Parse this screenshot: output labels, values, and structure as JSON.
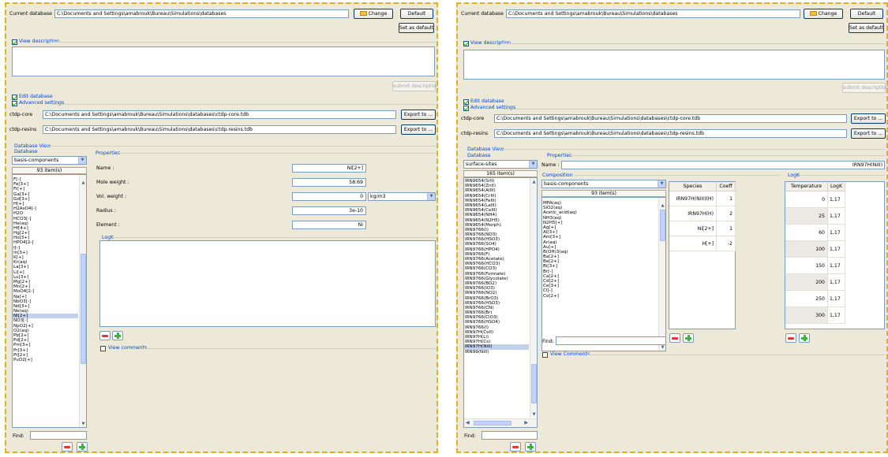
{
  "left": {
    "db_label": "Current database",
    "db_path": "C:\\Documents and Settings\\amabrouk\\Bureau\\Simulations\\databases",
    "change_label": "Change",
    "default_label": "Default",
    "set_default_label": "Set as default",
    "view_description_label": "View description",
    "submit_description_label": "submit description",
    "edit_database_label": "Edit database",
    "advanced_settings_label": "Advanced settings",
    "core_label": "ctdp-core",
    "core_path": "C:\\Documents and Settings\\amabrouk\\Bureau\\Simulations\\databases\\ctdp-core.tdb",
    "resins_label": "ctdp-resins",
    "resins_path": "C:\\Documents and Settings\\amabrouk\\Bureau\\Simulations\\databases\\ctdp-resins.tdb",
    "export_label": "Export to ...",
    "db_view_label": "Database View",
    "database_label": "Database",
    "db_select": "basis-components",
    "item_count": "93  item(s)",
    "items": [
      "F[-]",
      "Fe[3+]",
      "Fr[+]",
      "Ga[3+]",
      "Gd[3+]",
      "H[+]",
      "H2AsO4[-]",
      "H2O",
      "HCO3[-]",
      "He(aq)",
      "Hf[4+]",
      "Hg[2+]",
      "Ho[3+]",
      "HPO4[2-]",
      "I[-]",
      "In[3+]",
      "K[+]",
      "Kr(aq)",
      "La[3+]",
      "Li[+]",
      "Lu[3+]",
      "Mg[2+]",
      "Mn[2+]",
      "MoO4[2-]",
      "Na[+]",
      "NbO3[-]",
      "Nd[3+]",
      "Ne(aq)",
      "Ni[2+]",
      "NO3[-]",
      "NpO2[+]",
      "O2(aq)",
      "Pb[2+]",
      "Pd[2+]",
      "Pm[3+]",
      "Pr[3+]",
      "Pt[2+]",
      "PuO2[+]"
    ],
    "selected_index": 28,
    "find_label": "Find:",
    "find_value": "",
    "properties_label": "Properties",
    "name_label": "Name :",
    "name_value": "Ni[2+]",
    "mole_weight_label": "Mole weight :",
    "mole_weight_value": "58.69",
    "vol_weight_label": "Vol. weight :",
    "vol_weight_value": "0",
    "vol_weight_unit": "kg/m3",
    "radius_label": "Radius :",
    "radius_value": "3e-10",
    "element_label": "Element :",
    "element_value": "Ni",
    "logk_label": "LogK",
    "view_comments_label": "View comments"
  },
  "right": {
    "db_label": "Current database",
    "db_path": "C:\\Documents and Settings\\amabrouk\\Bureau\\Simulations\\databases",
    "change_label": "Change",
    "default_label": "Default",
    "set_default_label": "Set as default",
    "view_description_label": "View description",
    "submit_description_label": "submit description",
    "edit_database_label": "Edit database",
    "advanced_settings_label": "Advanced settings",
    "core_label": "ctdp-core",
    "core_path": "C:\\Documents and Settings\\amabrouk\\Bureau\\Simulations\\databases\\ctdp-core.tdb",
    "resins_label": "ctdp-resins",
    "resins_path": "C:\\Documents and Settings\\amabrouk\\Bureau\\Simulations\\databases\\ctdp-resins.tdb",
    "export_label": "Export to ...",
    "db_view_label": "Database View",
    "database_label": "Database",
    "db_select": "surface-sites",
    "item_count": "165  item(s)",
    "items": [
      "IRN9654(SrII)",
      "IRN9654(ZnII)",
      "IRN9654(AlIII)",
      "IRN9654(CrIII)",
      "IRN9654(FeIII)",
      "IRN9654(LaIII)",
      "IRN9654(CeIII)",
      "IRN9654(NH4)",
      "IRN9654(N2H5)",
      "IRN9654(Morph)",
      "IRN9766(I)",
      "IRN9766(NO3)",
      "IRN9766(HSO3)",
      "IRN9766(SO4)",
      "IRN9766(HPO4)",
      "IRN9766(F)",
      "IRN9766(Acetate)",
      "IRN9766(HCO3)",
      "IRN9766(CO3)",
      "IRN9766(Formate)",
      "IRN9766(Glycolate)",
      "IRN9766(BO2)",
      "IRN9766(IO3)",
      "IRN9766(NO2)",
      "IRN9766(BrO3)",
      "IRN9766(HSO3)",
      "IRN9766(CN)",
      "IRN9766(Br)",
      "IRN9766(ClO3)",
      "IRN9766(HSO4)",
      "IRN9766(I)",
      "IRN97H(CoII)",
      "IRN97H(Li)",
      "IRN97H(Cs)",
      "IRN97H(NiII)",
      "IRN99(NiII)"
    ],
    "selected_index": 34,
    "find_label": "Find:",
    "find_value": "",
    "properties_label": "Properties",
    "name_label": "Name :",
    "name_value": "IRN97H(NiII)",
    "composition_label": "Composition",
    "comp_select": "basis-components",
    "comp_count": "93  item(s)",
    "comp_items": [
      "MPA(aq)",
      "SiO2(aq)",
      "Acetic_acid(aq)",
      "NH3(aq)",
      "N2H5[+]",
      "Ag[+]",
      "Al[3+]",
      "Am[3+]",
      "Ar(aq)",
      "Au[+]",
      "B(OH)3(aq)",
      "Ba[2+]",
      "Be[2+]",
      "Bi[3+]",
      "Br[-]",
      "Ca[2+]",
      "Cd[2+]",
      "Ce[3+]",
      "Cl[-]",
      "Co[2+]"
    ],
    "comp_find_label": "Find:",
    "species_header": "Species",
    "coeff_header": "Coeff",
    "species_rows": [
      {
        "species": "IRN97H(NiII)(H)",
        "coeff": "1"
      },
      {
        "species": "IRN97H(H)",
        "coeff": "2"
      },
      {
        "species": "Ni[2+]",
        "coeff": "1"
      },
      {
        "species": "H[+]",
        "coeff": "-2"
      }
    ],
    "logk_label": "LogK",
    "temp_header": "Temperature",
    "logk_header": "LogK",
    "logk_rows": [
      {
        "t": "0",
        "k": "1,17"
      },
      {
        "t": "25",
        "k": "1,17"
      },
      {
        "t": "60",
        "k": "1,17"
      },
      {
        "t": "100",
        "k": "1,17"
      },
      {
        "t": "150",
        "k": "1,17"
      },
      {
        "t": "200",
        "k": "1,17"
      },
      {
        "t": "250",
        "k": "1,17"
      },
      {
        "t": "300",
        "k": "1,17"
      }
    ],
    "view_comments_label": "View Comments"
  }
}
